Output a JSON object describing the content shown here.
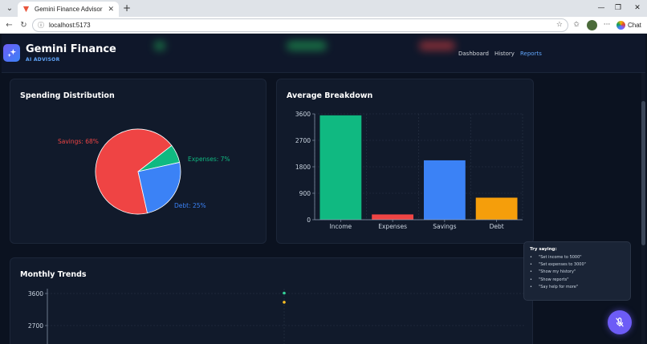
{
  "browser": {
    "tab_title": "Gemini Finance Advisor",
    "url": "localhost:5173",
    "chat_label": "Chat"
  },
  "app": {
    "brand_title": "Gemini Finance",
    "brand_sub": "AI ADVISOR",
    "nav": [
      "Dashboard",
      "History",
      "Reports"
    ],
    "active_nav": "Reports"
  },
  "cards": {
    "spending_title": "Spending Distribution",
    "average_title": "Average Breakdown",
    "monthly_title": "Monthly Trends"
  },
  "tips": {
    "title": "Try saying:",
    "items": [
      "\"Set income to 5000\"",
      "\"Set expenses to 3000\"",
      "\"Show my history\"",
      "\"Show reports\"",
      "\"Say help for more\""
    ]
  },
  "colors": {
    "income": "#10b981",
    "expenses": "#ef4444",
    "savings": "#3b82f6",
    "debt": "#f59e0b"
  },
  "chart_data": [
    {
      "type": "pie",
      "title": "Spending Distribution",
      "slices": [
        {
          "name": "Savings",
          "value": 68,
          "label": "Savings: 68%",
          "color": "#ef4444"
        },
        {
          "name": "Expenses",
          "value": 7,
          "label": "Expenses: 7%",
          "color": "#10b981"
        },
        {
          "name": "Debt",
          "value": 25,
          "label": "Debt: 25%",
          "color": "#3b82f6"
        }
      ]
    },
    {
      "type": "bar",
      "title": "Average Breakdown",
      "categories": [
        "Income",
        "Expenses",
        "Savings",
        "Debt"
      ],
      "values": [
        3550,
        180,
        2020,
        750
      ],
      "colors": [
        "#10b981",
        "#ef4444",
        "#3b82f6",
        "#f59e0b"
      ],
      "yticks": [
        0,
        900,
        1800,
        2700,
        3600
      ],
      "ylim": [
        0,
        3600
      ],
      "grid": true
    },
    {
      "type": "scatter",
      "title": "Monthly Trends",
      "yticks": [
        2700,
        3600
      ],
      "ylim": [
        0,
        3600
      ],
      "points": [
        {
          "y": 3600,
          "color": "#34d399"
        },
        {
          "y": 3550,
          "color": "#fbbf24"
        }
      ],
      "grid": true
    }
  ]
}
